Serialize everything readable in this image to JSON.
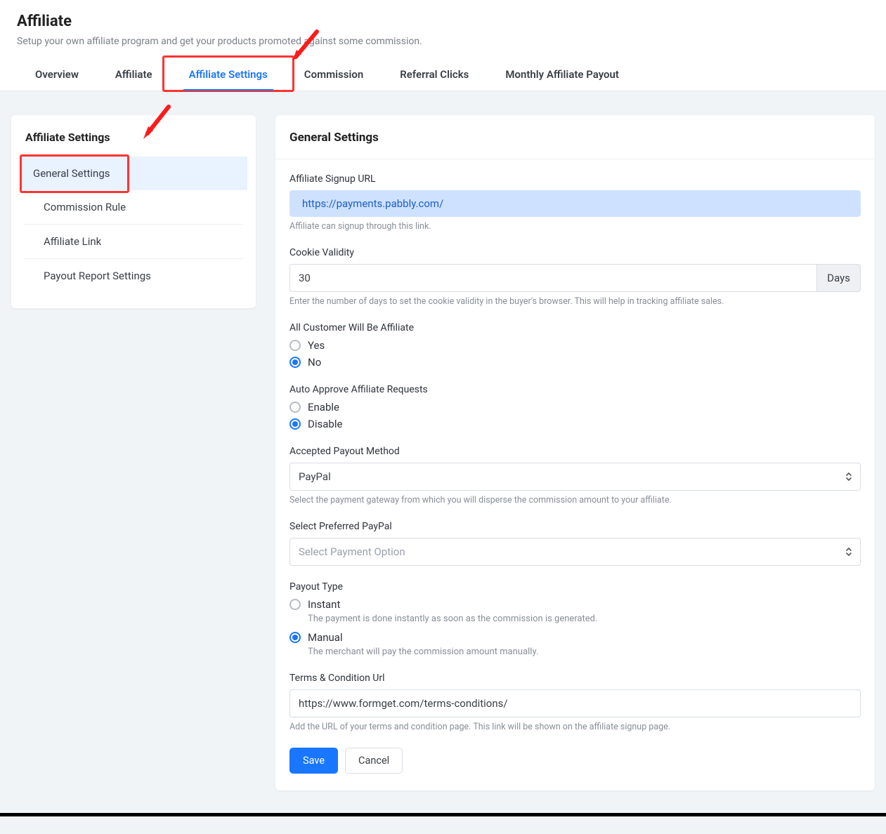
{
  "header": {
    "title": "Affiliate",
    "subtitle": "Setup your own affiliate program and get your products promoted against some commission."
  },
  "tabs": [
    {
      "label": "Overview"
    },
    {
      "label": "Affiliate"
    },
    {
      "label": "Affiliate Settings",
      "active": true
    },
    {
      "label": "Commission"
    },
    {
      "label": "Referral Clicks"
    },
    {
      "label": "Monthly Affiliate Payout"
    }
  ],
  "sidebar": {
    "title": "Affiliate Settings",
    "items": [
      {
        "label": "General Settings",
        "active": true
      },
      {
        "label": "Commission Rule"
      },
      {
        "label": "Affiliate Link"
      },
      {
        "label": "Payout Report Settings"
      }
    ]
  },
  "main": {
    "title": "General Settings",
    "signup_url": {
      "label": "Affiliate Signup URL",
      "value": "https://payments.pabbly.com/",
      "help": "Affiliate can signup through this link."
    },
    "cookie": {
      "label": "Cookie Validity",
      "value": "30",
      "addon": "Days",
      "help": "Enter the number of days to set the cookie validity in the buyer's browser. This will help in tracking affiliate sales."
    },
    "all_customer": {
      "label": "All Customer Will Be Affiliate",
      "yes": "Yes",
      "no": "No"
    },
    "auto_approve": {
      "label": "Auto Approve Affiliate Requests",
      "enable": "Enable",
      "disable": "Disable"
    },
    "payout_method": {
      "label": "Accepted Payout Method",
      "value": "PayPal",
      "help": "Select the payment gateway from which you will disperse the commission amount to your affiliate."
    },
    "preferred_paypal": {
      "label": "Select Preferred PayPal",
      "placeholder": "Select Payment Option"
    },
    "payout_type": {
      "label": "Payout Type",
      "instant": {
        "label": "Instant",
        "help": "The payment is done instantly as soon as the commission is generated."
      },
      "manual": {
        "label": "Manual",
        "help": "The merchant will pay the commission amount manually."
      }
    },
    "terms": {
      "label": "Terms & Condition Url",
      "value": "https://www.formget.com/terms-conditions/",
      "help": "Add the URL of your terms and condition page. This link will be shown on the affiliate signup page."
    },
    "buttons": {
      "save": "Save",
      "cancel": "Cancel"
    }
  }
}
